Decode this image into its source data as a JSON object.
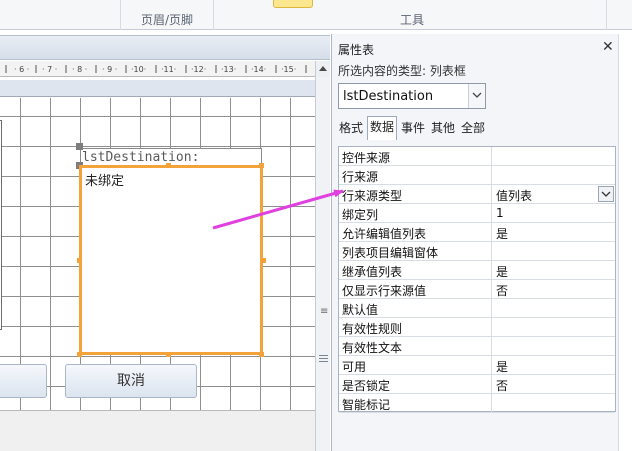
{
  "ribbon": {
    "groups": [
      {
        "label": "页眉/页脚"
      },
      {
        "label": "工具"
      }
    ]
  },
  "form": {
    "label_text": "lstDestination:",
    "listbox_text": "未绑定",
    "cancel_label": "取消"
  },
  "property_sheet": {
    "title": "属性表",
    "selection_type_label": "所选内容的类型: 列表框",
    "selected_control": "lstDestination",
    "tabs": [
      "格式",
      "数据",
      "事件",
      "其他",
      "全部"
    ],
    "active_tab": "数据",
    "rows": [
      {
        "name": "控件来源",
        "value": ""
      },
      {
        "name": "行来源",
        "value": ""
      },
      {
        "name": "行来源类型",
        "value": "值列表"
      },
      {
        "name": "绑定列",
        "value": "1"
      },
      {
        "name": "允许编辑值列表",
        "value": "是"
      },
      {
        "name": "列表项目编辑窗体",
        "value": ""
      },
      {
        "name": "继承值列表",
        "value": "是"
      },
      {
        "name": "仅显示行来源值",
        "value": "否"
      },
      {
        "name": "默认值",
        "value": ""
      },
      {
        "name": "有效性规则",
        "value": ""
      },
      {
        "name": "有效性文本",
        "value": ""
      },
      {
        "name": "可用",
        "value": "是"
      },
      {
        "name": "是否锁定",
        "value": "否"
      },
      {
        "name": "智能标记",
        "value": ""
      }
    ]
  },
  "colors": {
    "selection_outline": "#f3a33a",
    "annotation_arrow": "#e040e0"
  },
  "icons": [
    "close-icon",
    "dropdown-icon",
    "ruler",
    "splitter-grip-icon"
  ]
}
